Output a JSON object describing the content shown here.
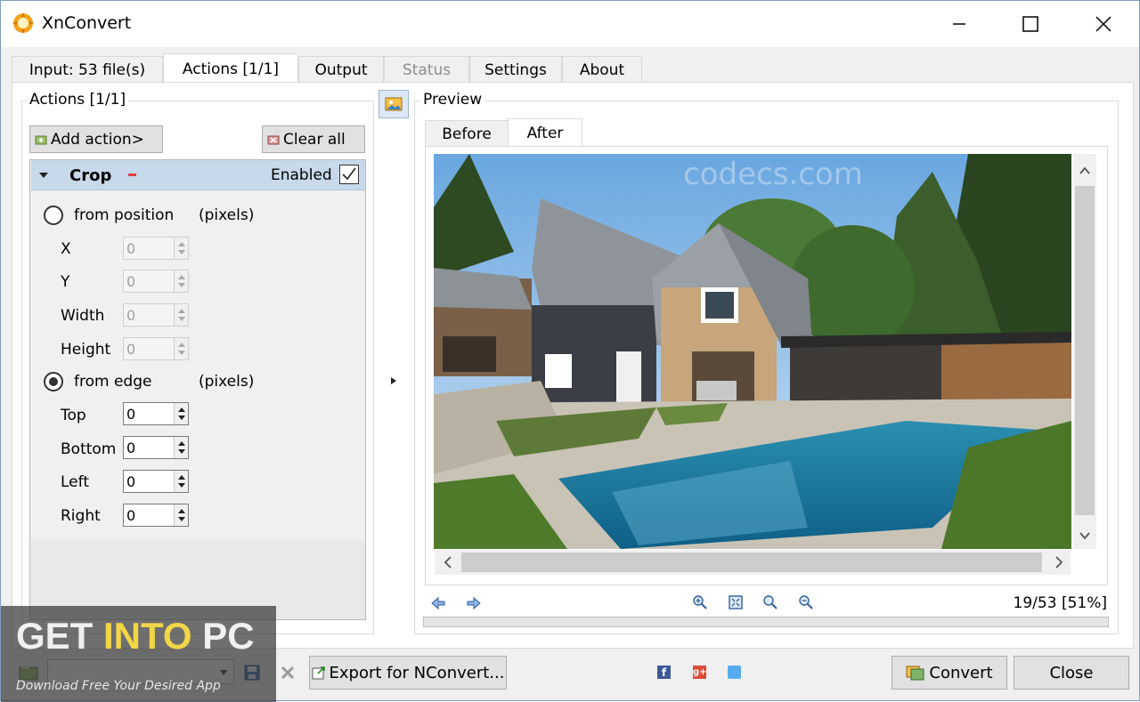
{
  "window": {
    "title": "XnConvert"
  },
  "tabs": [
    {
      "label": "Input: 53 file(s)"
    },
    {
      "label": "Actions [1/1]"
    },
    {
      "label": "Output"
    },
    {
      "label": "Status"
    },
    {
      "label": "Settings"
    },
    {
      "label": "About"
    }
  ],
  "actions": {
    "group_label": "Actions [1/1]",
    "add_label": "Add action>",
    "clear_label": "Clear all",
    "crop": {
      "title": "Crop",
      "enabled_label": "Enabled",
      "enabled": true,
      "from_position_label": "from position",
      "from_edge_label": "from edge",
      "pixels_label": "(pixels)",
      "selected_mode": "from edge",
      "position_fields": [
        {
          "label": "X",
          "value": "0"
        },
        {
          "label": "Y",
          "value": "0"
        },
        {
          "label": "Width",
          "value": "0"
        },
        {
          "label": "Height",
          "value": "0"
        }
      ],
      "edge_fields": [
        {
          "label": "Top",
          "value": "0"
        },
        {
          "label": "Bottom",
          "value": "0"
        },
        {
          "label": "Left",
          "value": "0"
        },
        {
          "label": "Right",
          "value": "0"
        }
      ]
    }
  },
  "preview": {
    "group_label": "Preview",
    "tabs": [
      "Before",
      "After"
    ],
    "active_tab": "After",
    "image_watermark": "codecs.com",
    "counter": "19/53 [51%]"
  },
  "footer": {
    "export_label": "Export for NConvert...",
    "convert_label": "Convert",
    "close_label": "Close"
  },
  "overlay": {
    "brand_get": "GET ",
    "brand_into": "INTO",
    "brand_pc": " PC",
    "tagline": "Download Free Your Desired App"
  },
  "colors": {
    "accent": "#c7d9ea",
    "link_blue": "#1f5fa8",
    "brand_yellow": "#f2d648"
  }
}
